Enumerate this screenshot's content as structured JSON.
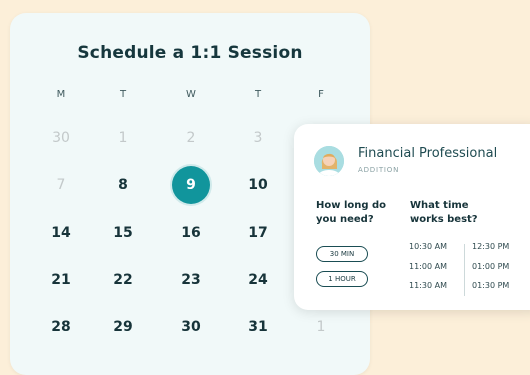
{
  "calendar": {
    "title": "Schedule a 1:1 Session",
    "weekdays": [
      "M",
      "T",
      "W",
      "T",
      "F"
    ],
    "weeks": [
      [
        "30",
        "1",
        "2",
        "3",
        ""
      ],
      [
        "7",
        "8",
        "9",
        "10",
        ""
      ],
      [
        "14",
        "15",
        "16",
        "17",
        ""
      ],
      [
        "21",
        "22",
        "23",
        "24",
        ""
      ],
      [
        "28",
        "29",
        "30",
        "31",
        "1"
      ]
    ],
    "selected_day": "9"
  },
  "professional": {
    "name": "Financial Professional",
    "role": "ADDITION"
  },
  "duration": {
    "question_line1": "How long do",
    "question_line2": "you need?",
    "options": [
      "30 MIN",
      "1 HOUR"
    ]
  },
  "time": {
    "question_line1": "What time",
    "question_line2": "works best?",
    "column1": [
      "10:30 AM",
      "11:00 AM",
      "11:30 AM"
    ],
    "column2": [
      "12:30 PM",
      "01:00 PM",
      "01:30 PM"
    ]
  },
  "colors": {
    "background": "#fcefd9",
    "calendar_card": "#f1f9f9",
    "accent": "#11959c"
  }
}
